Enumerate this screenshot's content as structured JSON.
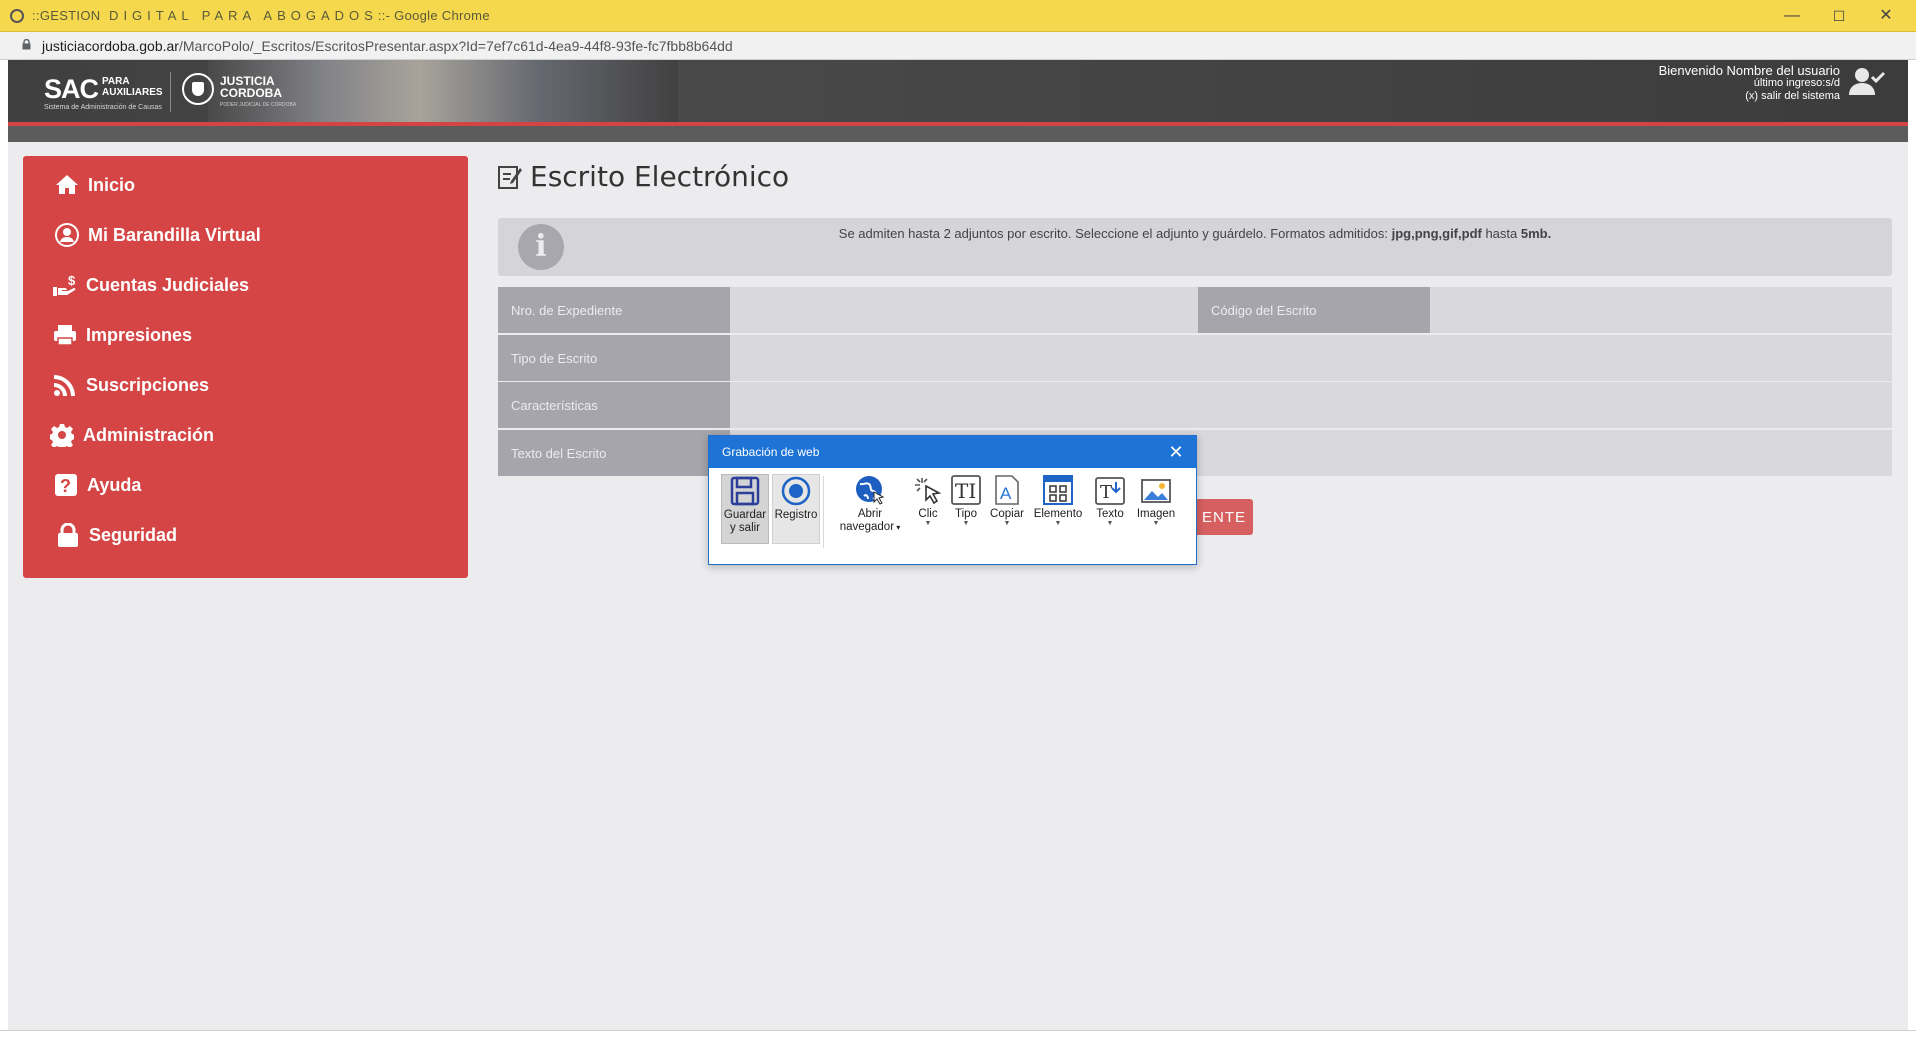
{
  "browser": {
    "title_prefix": "::GESTION",
    "title_spaced": " DIGITAL  PARA  ABOGADOS",
    "title_suffix": "::- Google Chrome",
    "url_host": "justiciacordoba.gob.ar",
    "url_path": "/MarcoPolo/_Escritos/EscritosPresentar.aspx?Id=7ef7c61d-4ea9-44f8-93fe-fc7fbb8b64dd",
    "minimize": "—",
    "maximize": "☐",
    "close": "✕"
  },
  "header": {
    "brand": "SAC",
    "brand_sub_1": "PARA",
    "brand_sub_2": "AUXILIARES",
    "brand_tag": "Sistema de Administración de Causas",
    "org_1": "JUSTICIA",
    "org_2": "CORDOBA",
    "org_tag": "PODER JUDICIAL DE CÓRDOBA",
    "welcome": "Bienvenido Nombre del usuario",
    "last_login": "último ingreso:s/d",
    "logout": "(x) salir del sistema"
  },
  "sidebar": {
    "items": [
      {
        "label": "Inicio",
        "icon": "home-icon"
      },
      {
        "label": "Mi Barandilla Virtual",
        "icon": "user-circle-icon"
      },
      {
        "label": "Cuentas Judiciales",
        "icon": "hand-money-icon"
      },
      {
        "label": "Impresiones",
        "icon": "printer-icon"
      },
      {
        "label": "Suscripciones",
        "icon": "rss-icon"
      },
      {
        "label": "Administración",
        "icon": "gear-icon"
      },
      {
        "label": "Ayuda",
        "icon": "question-icon"
      },
      {
        "label": "Seguridad",
        "icon": "lock-icon"
      }
    ]
  },
  "main": {
    "title": "Escrito Electrónico",
    "info_text": "Se admiten hasta 2 adjuntos por escrito. Seleccione el adjunto y guárdelo. Formatos admitidos: ",
    "info_formats": "jpg,png,gif,pdf",
    "info_mid": " hasta ",
    "info_size": "5mb.",
    "fields": {
      "expediente": "Nro. de Expediente",
      "codigo": "Código del Escrito",
      "tipo": "Tipo de Escrito",
      "caracteristicas": "Características",
      "texto": "Texto del Escrito"
    },
    "red_button": "ENTE"
  },
  "recorder": {
    "title": "Grabación de web",
    "tools": [
      {
        "label_1": "Guardar",
        "label_2": "y salir"
      },
      {
        "label_1": "Registro",
        "label_2": ""
      },
      {
        "label_1": "Abrir",
        "label_2": "navegador"
      },
      {
        "label_1": "Clic",
        "label_2": ""
      },
      {
        "label_1": "Tipo",
        "label_2": ""
      },
      {
        "label_1": "Copiar",
        "label_2": ""
      },
      {
        "label_1": "Elemento",
        "label_2": ""
      },
      {
        "label_1": "Texto",
        "label_2": ""
      },
      {
        "label_1": "Imagen",
        "label_2": ""
      }
    ],
    "accent": "#1e73d6"
  }
}
